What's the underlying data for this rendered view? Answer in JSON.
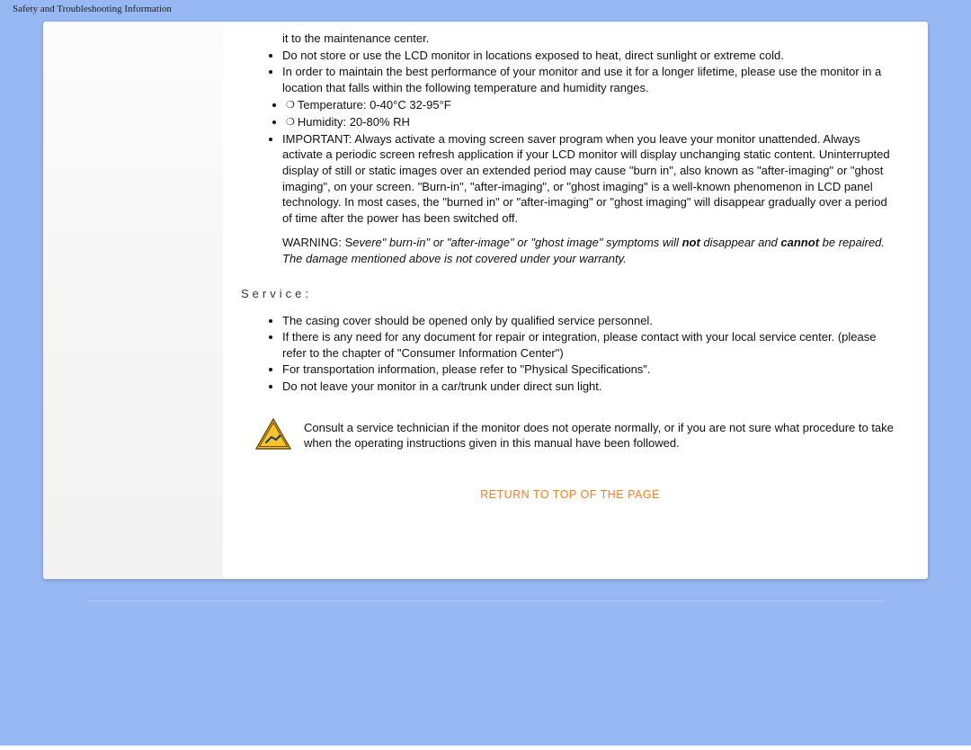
{
  "header": {
    "title": "Safety and Troubleshooting Information"
  },
  "content": {
    "pre_service_li1": "it to the maintenance center.",
    "pre_service_li2": "Do not store or use the LCD monitor in locations exposed to heat, direct sunlight or extreme cold.",
    "pre_service_li3": "In order to maintain the best performance of your monitor and use it for a longer lifetime, please use the monitor in a location that falls within the following temperature and humidity ranges.",
    "sub_li_temp": "Temperature: 0-40°C 32-95°F",
    "sub_li_humid": "Humidity: 20-80% RH",
    "pre_service_li4": "IMPORTANT: Always activate a moving screen saver program when you leave your monitor unattended. Always activate a periodic screen refresh application if your LCD monitor will display unchanging static content. Uninterrupted display of still or static images over an extended period may cause \"burn in\", also known as \"after-imaging\" or \"ghost imaging\", on your screen. \"Burn-in\", \"after-imaging\", or \"ghost imaging\" is a well-known phenomenon in LCD panel technology. In most cases, the \"burned in\" or \"after-imaging\" or \"ghost imaging\" will disappear gradually over a period of time after the power has been switched off.",
    "warning_lead": "WARNING: S",
    "warning_mid1": "evere\" burn-in\" or \"after-image\" or \"ghost image\" symptoms will ",
    "warning_not": "not",
    "warning_mid2": " disappear and ",
    "warning_cannot": "cannot",
    "warning_tail": " be repaired. The damage mentioned above is not covered under your warranty.",
    "service_label": "Service:",
    "svc_li1": "The casing cover should be opened only by qualified service personnel.",
    "svc_li2": "If there is any need for any document for repair or integration, please contact with your local service center. (please refer to the chapter of \"Consumer Information Center\")",
    "svc_li3": "For transportation information, please refer to \"Physical Specifications\".",
    "svc_li4": "Do not leave your monitor in a car/trunk under direct sun light.",
    "consult_text": "Consult a service technician if the monitor does not operate normally, or if you are not sure what procedure to take when the operating instructions given in this manual have been followed.",
    "return_link": "RETURN TO TOP OF THE PAGE"
  },
  "icons": {
    "warning": "warning-triangle-icon"
  },
  "colors": {
    "bg": "#97b8f3",
    "link": "#ff7a1a"
  }
}
